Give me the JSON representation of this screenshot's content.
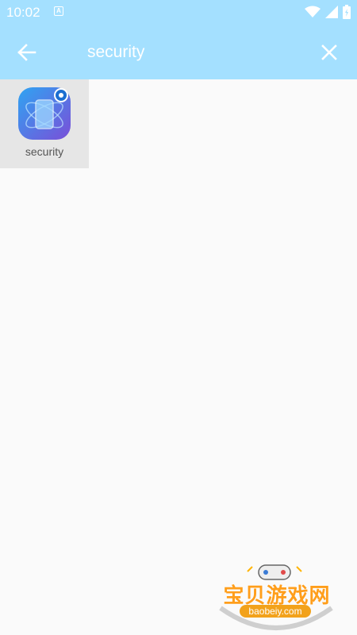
{
  "status_bar": {
    "time": "10:02"
  },
  "toolbar": {
    "search_value": "security"
  },
  "results": [
    {
      "label": "security",
      "icon": "security-app-icon"
    }
  ],
  "watermark": {
    "title": "宝贝游戏网",
    "url": "baobeiy.com"
  },
  "colors": {
    "toolbar_bg": "#a4e0ff",
    "page_bg": "#fafafa",
    "tile_bg": "#e6e6e6"
  }
}
